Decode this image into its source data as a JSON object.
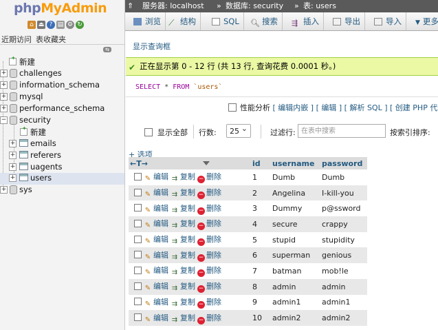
{
  "logo": {
    "part1": "php",
    "part2": "MyAdmin"
  },
  "nav": {
    "tabs": [
      "近期访问",
      "表收藏夹"
    ],
    "tree": [
      {
        "label": "新建",
        "type": "new"
      },
      {
        "label": "challenges",
        "type": "db"
      },
      {
        "label": "information_schema",
        "type": "db"
      },
      {
        "label": "mysql",
        "type": "db"
      },
      {
        "label": "performance_schema",
        "type": "db"
      },
      {
        "label": "security",
        "type": "db",
        "expanded": true
      },
      {
        "label": "新建",
        "type": "new"
      },
      {
        "label": "emails",
        "type": "table"
      },
      {
        "label": "referers",
        "type": "table"
      },
      {
        "label": "uagents",
        "type": "table"
      },
      {
        "label": "users",
        "type": "table",
        "selected": true
      },
      {
        "label": "sys",
        "type": "db"
      }
    ]
  },
  "breadcrumb": {
    "server": "服务器: localhost",
    "database": "数据库: security",
    "table": "表: users",
    "sep": "»"
  },
  "tabs": [
    "浏览",
    "结构",
    "SQL",
    "搜索",
    "插入",
    "导出",
    "导入",
    "更多"
  ],
  "query": {
    "show_link": "显示查询框",
    "success": "正在显示第 0 - 12 行 (共 13 行, 查询花费 0.0001 秒。)",
    "sql_select": "SELECT",
    "sql_star": " * ",
    "sql_from": "FROM",
    "sql_table": " `users`"
  },
  "profiling": {
    "label": "性能分析",
    "links": [
      "[ 编辑内嵌 ]",
      "[ 编辑 ]",
      "[ 解析 SQL ]",
      "[ 创建 PHP 代码 ]",
      "["
    ]
  },
  "navigation": {
    "show_all": "显示全部",
    "rows_label": "行数:",
    "rows_value": "25",
    "filter_label": "过滤行:",
    "filter_placeholder": "在表中搜索",
    "sort_label": "按索引排序:"
  },
  "options_link": "+ 选项",
  "table": {
    "nav_arrows": "←T→",
    "columns": [
      "id",
      "username",
      "password"
    ],
    "actions": {
      "edit": "编辑",
      "copy": "复制",
      "delete": "删除"
    },
    "rows": [
      {
        "id": "1",
        "username": "Dumb",
        "password": "Dumb"
      },
      {
        "id": "2",
        "username": "Angelina",
        "password": "I-kill-you"
      },
      {
        "id": "3",
        "username": "Dummy",
        "password": "p@ssword"
      },
      {
        "id": "4",
        "username": "secure",
        "password": "crappy"
      },
      {
        "id": "5",
        "username": "stupid",
        "password": "stupidity"
      },
      {
        "id": "6",
        "username": "superman",
        "password": "genious"
      },
      {
        "id": "7",
        "username": "batman",
        "password": "mob!le"
      },
      {
        "id": "8",
        "username": "admin",
        "password": "admin"
      },
      {
        "id": "9",
        "username": "admin1",
        "password": "admin1"
      },
      {
        "id": "10",
        "username": "admin2",
        "password": "admin2"
      }
    ]
  },
  "colors": {
    "link": "#235a81",
    "success_bg": "#ebf8a4",
    "breadcrumb_bg": "#5a5a5a"
  }
}
